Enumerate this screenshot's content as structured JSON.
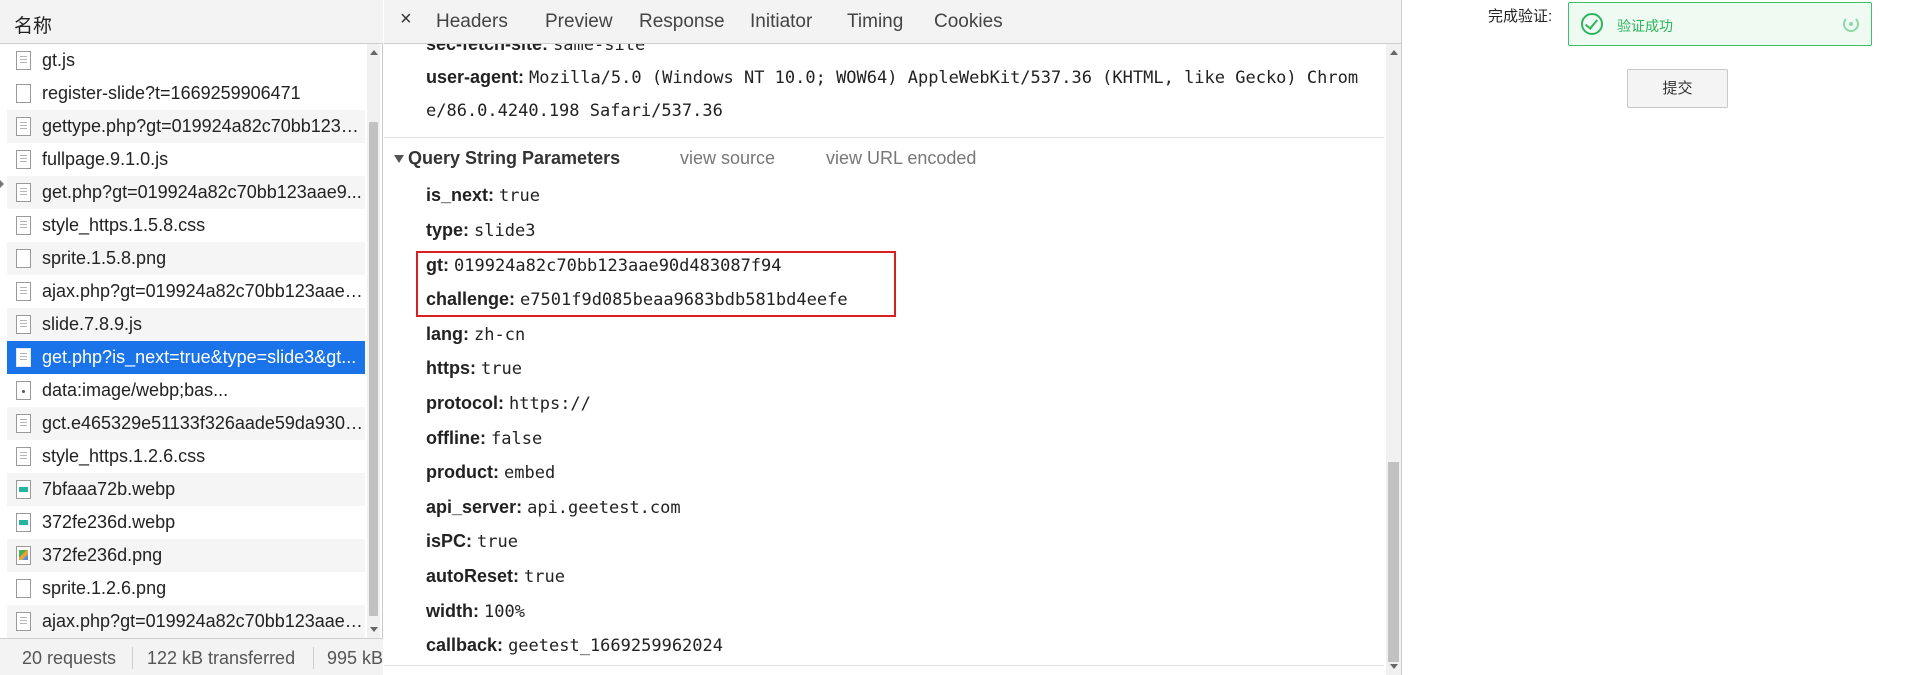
{
  "request_list": {
    "header": "名称",
    "rows": [
      {
        "name": "gt.js",
        "icon": "document-icon"
      },
      {
        "name": "register-slide?t=1669259906471",
        "icon": "blank-file-icon"
      },
      {
        "name": "gettype.php?gt=019924a82c70bb123a...",
        "icon": "document-icon"
      },
      {
        "name": "fullpage.9.1.0.js",
        "icon": "document-icon"
      },
      {
        "name": "get.php?gt=019924a82c70bb123aae9...",
        "icon": "document-icon"
      },
      {
        "name": "style_https.1.5.8.css",
        "icon": "document-icon"
      },
      {
        "name": "sprite.1.5.8.png",
        "icon": "blank-file-icon"
      },
      {
        "name": "ajax.php?gt=019924a82c70bb123aae9...",
        "icon": "document-icon"
      },
      {
        "name": "slide.7.8.9.js",
        "icon": "document-icon"
      },
      {
        "name": "get.php?is_next=true&type=slide3&gt...",
        "icon": "document-icon",
        "selected": true
      },
      {
        "name": "data:image/webp;bas...",
        "icon": "data-file-icon"
      },
      {
        "name": "gct.e465329e51133f326aade59da930c...",
        "icon": "document-icon"
      },
      {
        "name": "style_https.1.2.6.css",
        "icon": "document-icon"
      },
      {
        "name": "7bfaaa72b.webp",
        "icon": "webp-image-icon"
      },
      {
        "name": "372fe236d.webp",
        "icon": "webp-image-icon"
      },
      {
        "name": "372fe236d.png",
        "icon": "png-image-icon"
      },
      {
        "name": "sprite.1.2.6.png",
        "icon": "blank-file-icon"
      },
      {
        "name": "ajax.php?gt=019924a82c70bb123aae9...",
        "icon": "document-icon"
      }
    ]
  },
  "status_bar": {
    "requests": "20 requests",
    "transferred": "122 kB transferred",
    "resources": "995 kB"
  },
  "tabs": {
    "close": "×",
    "headers": "Headers",
    "preview": "Preview",
    "response": "Response",
    "initiator": "Initiator",
    "timing": "Timing",
    "cookies": "Cookies"
  },
  "request_headers": {
    "sec_fetch_site_key": "sec-fetch-site:",
    "sec_fetch_site_value": "same-site",
    "user_agent_key": "user-agent:",
    "user_agent_line1": "Mozilla/5.0 (Windows NT 10.0; WOW64) AppleWebKit/537.36 (KHTML, like Gecko) Chrom",
    "user_agent_line2": "e/86.0.4240.198 Safari/537.36"
  },
  "query_section": {
    "title": "Query String Parameters",
    "view_source": "view source",
    "view_url_encoded": "view URL encoded"
  },
  "params": [
    {
      "key": "is_next:",
      "value": "true"
    },
    {
      "key": "type:",
      "value": "slide3"
    },
    {
      "key": "gt:",
      "value": "019924a82c70bb123aae90d483087f94"
    },
    {
      "key": "challenge:",
      "value": "e7501f9d085beaa9683bdb581bd4eefe"
    },
    {
      "key": "lang:",
      "value": "zh-cn"
    },
    {
      "key": "https:",
      "value": "true"
    },
    {
      "key": "protocol:",
      "value": "https://"
    },
    {
      "key": "offline:",
      "value": "false"
    },
    {
      "key": "product:",
      "value": "embed"
    },
    {
      "key": "api_server:",
      "value": "api.geetest.com"
    },
    {
      "key": "isPC:",
      "value": "true"
    },
    {
      "key": "autoReset:",
      "value": "true"
    },
    {
      "key": "width:",
      "value": "100%"
    },
    {
      "key": "callback:",
      "value": "geetest_1669259962024"
    }
  ],
  "page": {
    "verify_label": "完成验证:",
    "verify_status": "验证成功",
    "submit": "提交"
  },
  "colors": {
    "selected_row": "#1a73e8",
    "highlight_box": "#d92020",
    "success_green": "#2fb45c"
  }
}
